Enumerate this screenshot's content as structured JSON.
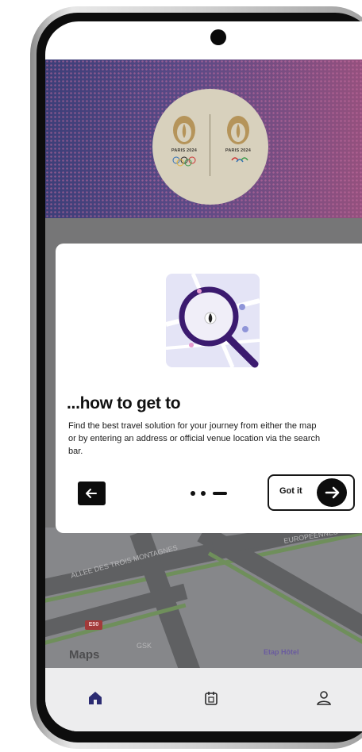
{
  "header": {
    "logos": [
      {
        "text": "PARIS 2024"
      },
      {
        "text": "PARIS 2024"
      }
    ]
  },
  "map": {
    "road_label_top": "EUROPEENNES",
    "road_label_left": "ALLEE DES TROIS MONTAGNES",
    "road_badge": "E50",
    "poi_hotel": "Etap Hôtel",
    "poi_gsk": "GSK",
    "attribution": "Maps"
  },
  "tutorial": {
    "title": "...how to get to",
    "body": "Find the best travel solution for your journey from either the map or by entering an address or official venue location via the search bar.",
    "confirm_label": "Got it",
    "page_count": 3,
    "current_page": 3
  },
  "bottom_nav": {
    "items": [
      {
        "name": "home",
        "icon": "home-icon",
        "active": true
      },
      {
        "name": "calendar",
        "icon": "calendar-icon",
        "active": false
      },
      {
        "name": "profile",
        "icon": "user-icon",
        "active": false
      }
    ]
  },
  "colors": {
    "hero_left": "#3c3e78",
    "hero_right": "#94507e",
    "accent_purple": "#3b1a6f",
    "nav_active": "#2c2c72"
  }
}
